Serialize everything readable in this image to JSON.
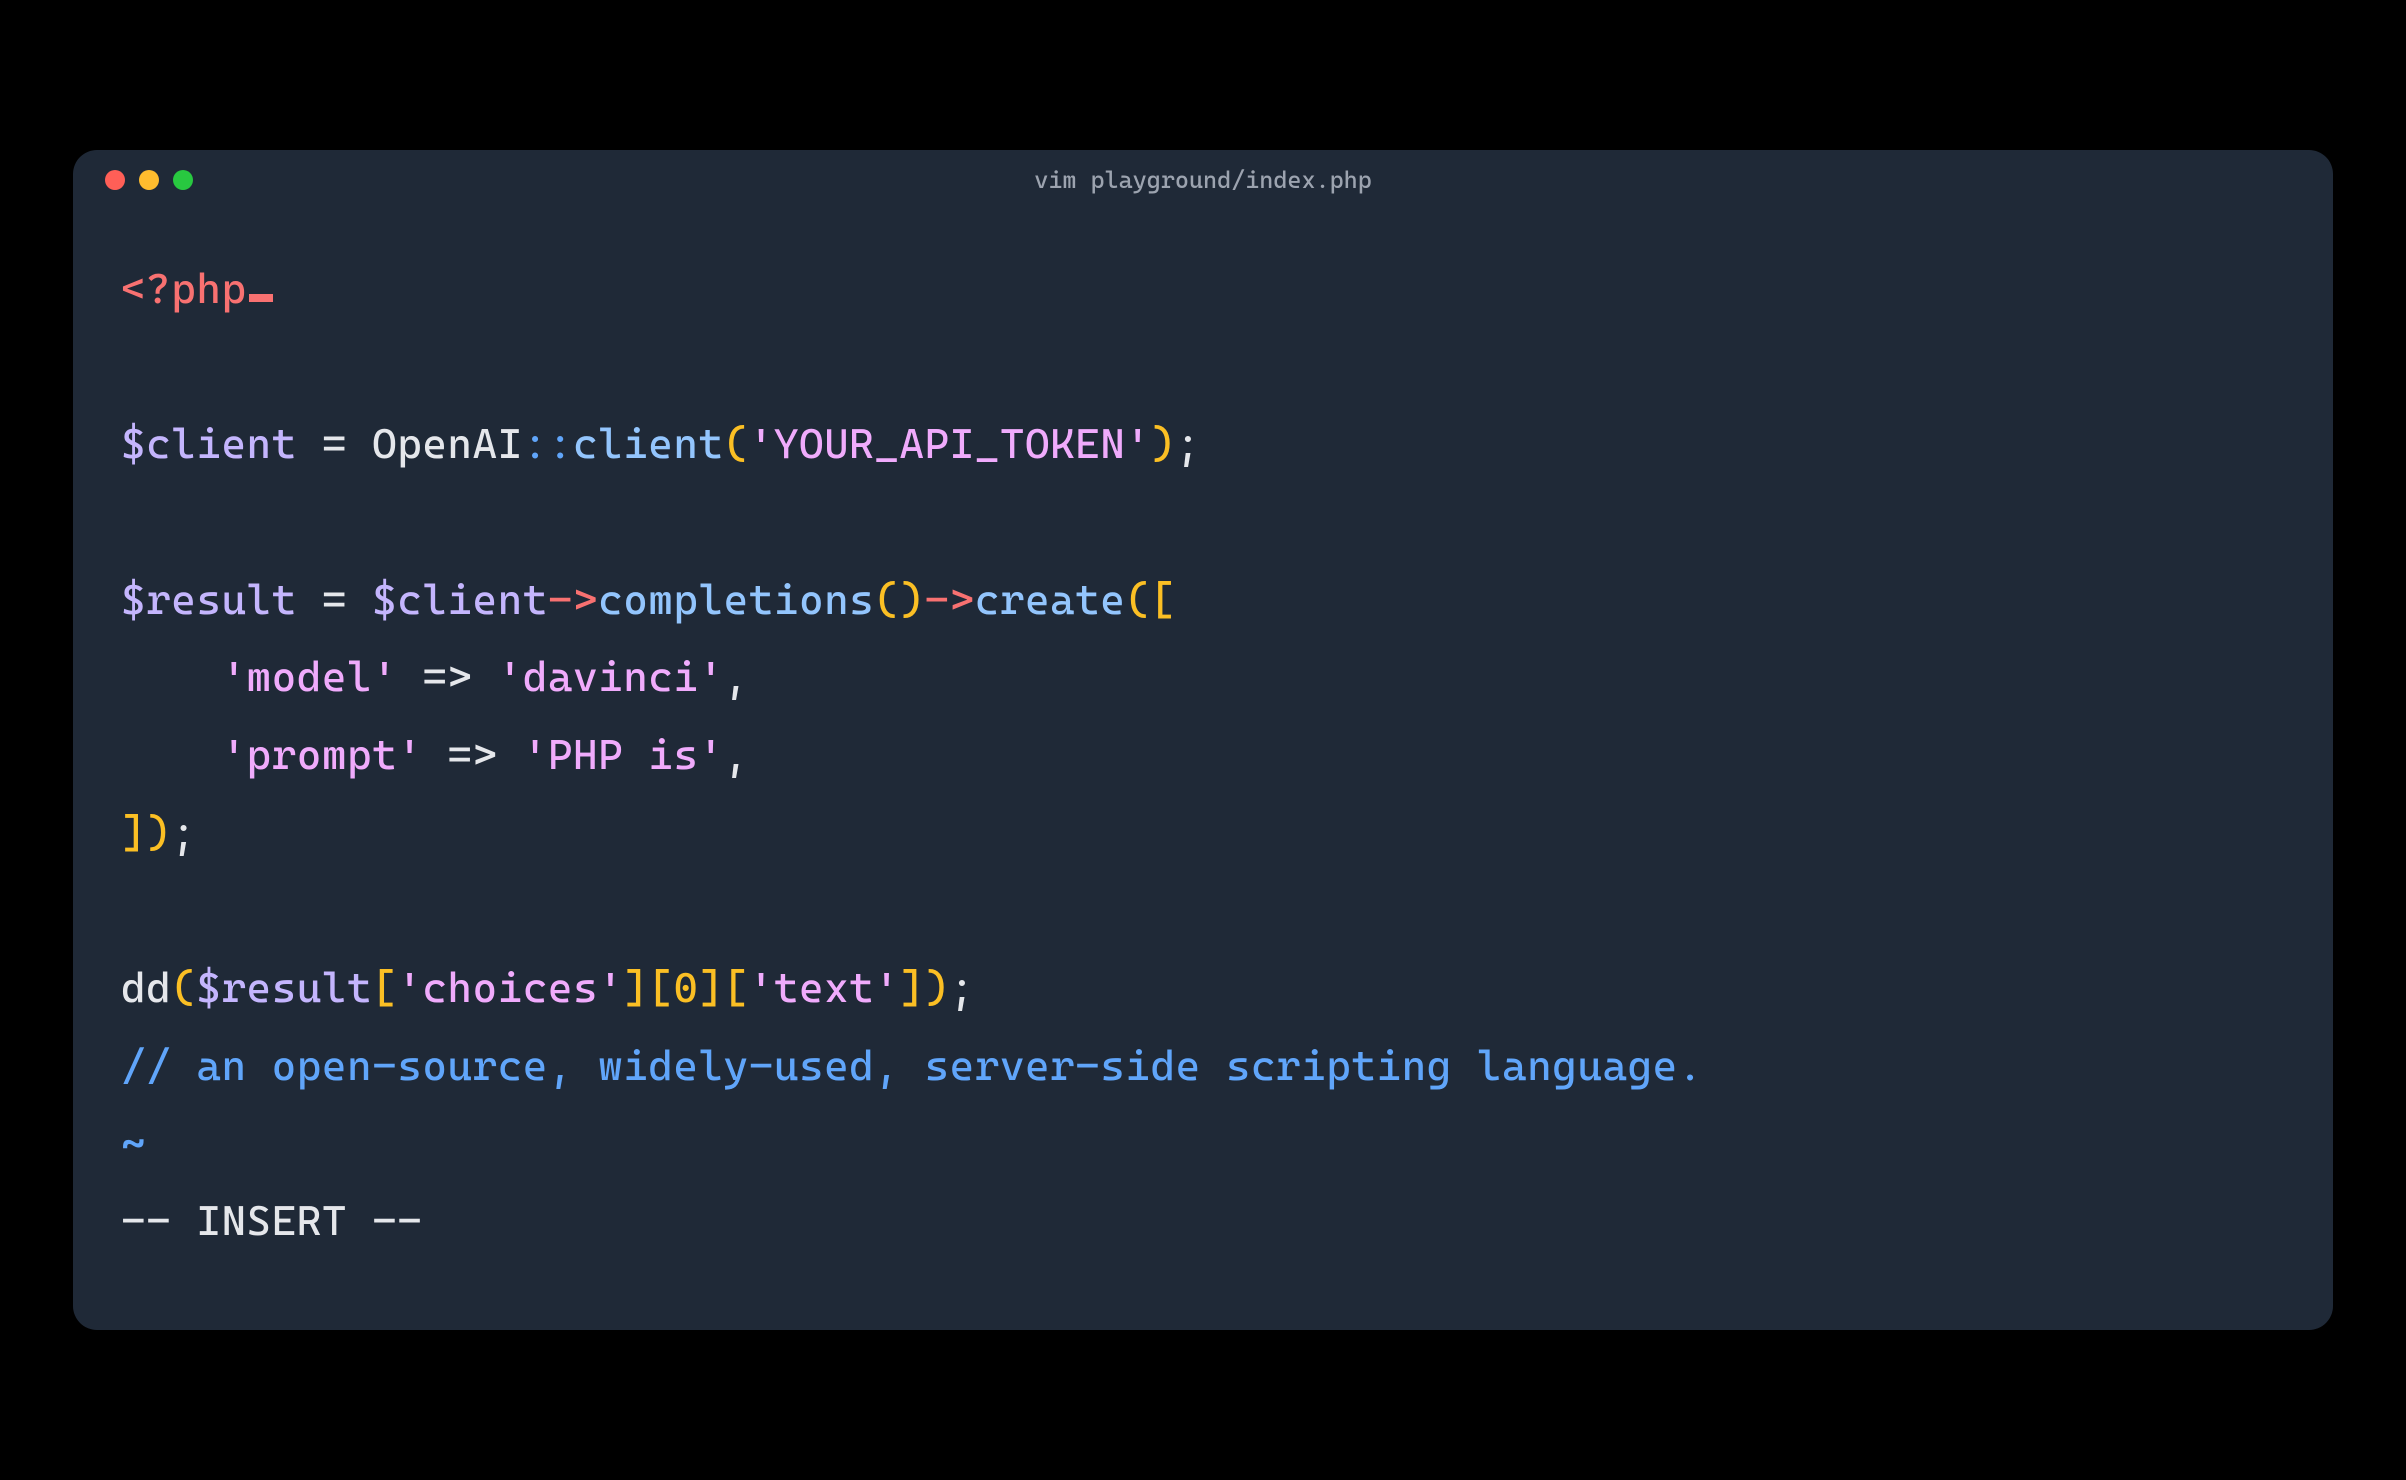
{
  "window": {
    "title": "vim playground/index.php"
  },
  "traffic_lights": {
    "red": "#ff5f57",
    "yellow": "#febc2e",
    "green": "#28c840"
  },
  "code": {
    "line1": {
      "open_tag": "<?php"
    },
    "line3": {
      "var": "$client",
      "eq": " = ",
      "class": "OpenAI",
      "scope": "::",
      "func": "client",
      "lparen": "(",
      "str": "'YOUR_API_TOKEN'",
      "rparen": ")",
      "semi": ";"
    },
    "line5": {
      "var1": "$result",
      "eq": " = ",
      "var2": "$client",
      "arrow1": "->",
      "func1": "completions",
      "paren1": "()",
      "arrow2": "->",
      "func2": "create",
      "lparen": "(",
      "lbracket": "["
    },
    "line6": {
      "indent": "    ",
      "key": "'model'",
      "arrow": " => ",
      "val": "'davinci'",
      "comma": ","
    },
    "line7": {
      "indent": "    ",
      "key": "'prompt'",
      "arrow": " => ",
      "val": "'PHP is'",
      "comma": ","
    },
    "line8": {
      "rbracket": "]",
      "rparen": ")",
      "semi": ";"
    },
    "line10": {
      "func": "dd",
      "lparen": "(",
      "var": "$result",
      "lbracket1": "[",
      "str1": "'choices'",
      "rbracket1": "]",
      "lbracket2": "[",
      "num": "0",
      "rbracket2": "]",
      "lbracket3": "[",
      "str2": "'text'",
      "rbracket3": "]",
      "rparen": ")",
      "semi": ";"
    },
    "line11": {
      "comment": "// an open-source, widely-used, server-side scripting language."
    },
    "line12": {
      "tilde": "~"
    },
    "line13": {
      "status": "-- INSERT --"
    }
  }
}
